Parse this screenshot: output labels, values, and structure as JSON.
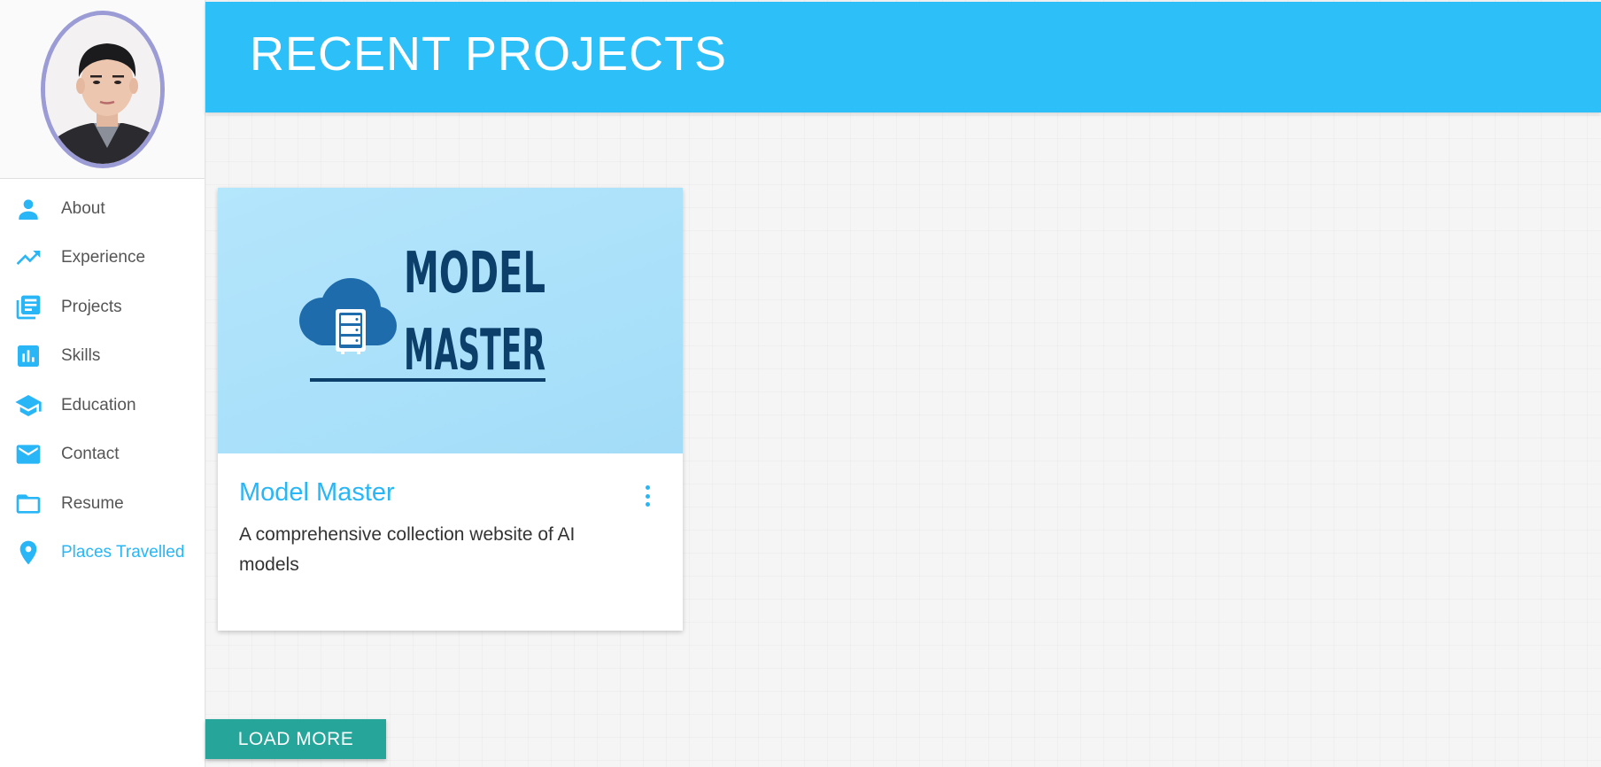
{
  "colors": {
    "accent": "#29b6f6",
    "header_bg": "#2dc0f8",
    "button_bg": "#26a69a",
    "avatar_border": "#9b9bd6"
  },
  "sidebar": {
    "items": [
      {
        "label": "About",
        "icon": "person-icon"
      },
      {
        "label": "Experience",
        "icon": "trending-up-icon"
      },
      {
        "label": "Projects",
        "icon": "library-books-icon"
      },
      {
        "label": "Skills",
        "icon": "bar-chart-icon"
      },
      {
        "label": "Education",
        "icon": "school-icon"
      },
      {
        "label": "Contact",
        "icon": "mail-icon"
      },
      {
        "label": "Resume",
        "icon": "folder-icon"
      },
      {
        "label": "Places Travelled",
        "icon": "place-icon",
        "active": true
      }
    ]
  },
  "header": {
    "title": "RECENT PROJECTS"
  },
  "projects": [
    {
      "logo_line1": "MODEL",
      "logo_line2": "MASTER",
      "title": "Model Master",
      "description": "A comprehensive collection website of AI models"
    }
  ],
  "load_more": {
    "label": "LOAD MORE"
  }
}
